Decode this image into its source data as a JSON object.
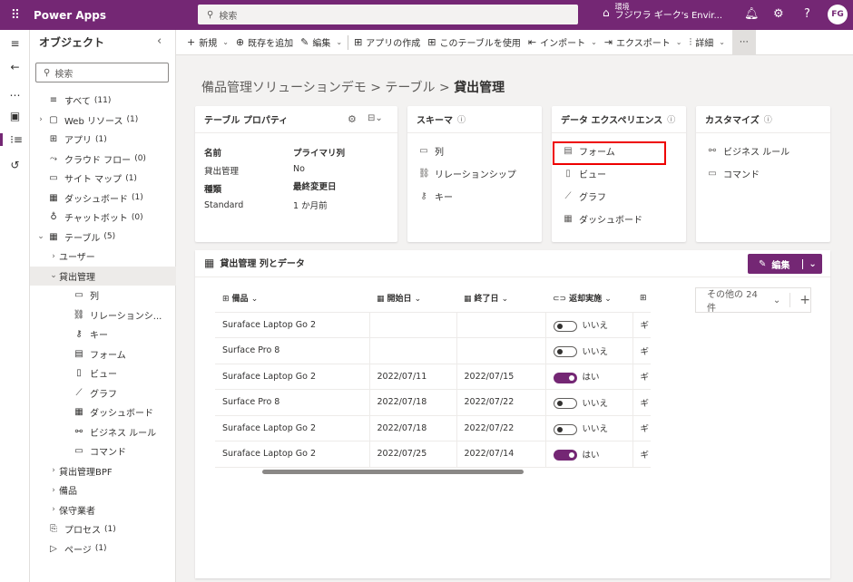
{
  "topbar": {
    "app_name": "Power Apps",
    "search_placeholder": "検索",
    "env_label": "環境",
    "env_name": "フジワラ ギーク's Envir...",
    "avatar_text": "FG"
  },
  "object_panel": {
    "title": "オブジェクト",
    "search_placeholder": "検索",
    "items": [
      {
        "label": "すべて",
        "count": "(11)",
        "icon": "≡",
        "chev": ""
      },
      {
        "label": "Web リソース",
        "count": "(1)",
        "icon": "▢",
        "chev": "›"
      },
      {
        "label": "アプリ",
        "count": "(1)",
        "icon": "⊞",
        "chev": ""
      },
      {
        "label": "クラウド フロー",
        "count": "(0)",
        "icon": "⤳",
        "chev": ""
      },
      {
        "label": "サイト マップ",
        "count": "(1)",
        "icon": "▭",
        "chev": ""
      },
      {
        "label": "ダッシュボード",
        "count": "(1)",
        "icon": "▦",
        "chev": ""
      },
      {
        "label": "チャットボット",
        "count": "(0)",
        "icon": "♁",
        "chev": ""
      },
      {
        "label": "テーブル",
        "count": "(5)",
        "icon": "▦",
        "chev": "⌄"
      },
      {
        "label": "ユーザー",
        "count": "",
        "icon": "",
        "chev": "›",
        "indent": 1
      },
      {
        "label": "貸出管理",
        "count": "",
        "icon": "",
        "chev": "⌄",
        "indent": 1,
        "selected": true
      },
      {
        "label": "列",
        "count": "",
        "icon": "▭",
        "chev": "",
        "indent": 2
      },
      {
        "label": "リレーションシ...",
        "count": "",
        "icon": "⛓",
        "chev": "",
        "indent": 2
      },
      {
        "label": "キー",
        "count": "",
        "icon": "⚷",
        "chev": "",
        "indent": 2
      },
      {
        "label": "フォーム",
        "count": "",
        "icon": "▤",
        "chev": "",
        "indent": 2
      },
      {
        "label": "ビュー",
        "count": "",
        "icon": "▯",
        "chev": "",
        "indent": 2
      },
      {
        "label": "グラフ",
        "count": "",
        "icon": "⟋",
        "chev": "",
        "indent": 2
      },
      {
        "label": "ダッシュボード",
        "count": "",
        "icon": "▦",
        "chev": "",
        "indent": 2
      },
      {
        "label": "ビジネス ルール",
        "count": "",
        "icon": "⚯",
        "chev": "",
        "indent": 2
      },
      {
        "label": "コマンド",
        "count": "",
        "icon": "▭",
        "chev": "",
        "indent": 2
      },
      {
        "label": "貸出管理BPF",
        "count": "",
        "icon": "",
        "chev": "›",
        "indent": 1
      },
      {
        "label": "備品",
        "count": "",
        "icon": "",
        "chev": "›",
        "indent": 1
      },
      {
        "label": "保守業者",
        "count": "",
        "icon": "",
        "chev": "›",
        "indent": 1
      },
      {
        "label": "プロセス",
        "count": "(1)",
        "icon": "⎘",
        "chev": ""
      },
      {
        "label": "ページ",
        "count": "(1)",
        "icon": "▷",
        "chev": ""
      }
    ]
  },
  "commands": [
    {
      "icon": "+",
      "label": "新規",
      "dd": true
    },
    {
      "icon": "⊕",
      "label": "既存を追加",
      "dd": false
    },
    {
      "icon": "✎",
      "label": "編集",
      "dd": true
    },
    {
      "icon": "⊞",
      "label": "アプリの作成",
      "dd": false
    },
    {
      "icon": "⊞",
      "label": "このテーブルを使用",
      "dd": false
    },
    {
      "icon": "⇤",
      "label": "インポート",
      "dd": true
    },
    {
      "icon": "⇥",
      "label": "エクスポート",
      "dd": true
    },
    {
      "icon": "⫶",
      "label": "詳細",
      "dd": true
    }
  ],
  "breadcrumb": {
    "part1": "備品管理ソリューションデモ",
    "sep": ">",
    "part2": "テーブル",
    "current": "貸出管理"
  },
  "props_card": {
    "title": "テーブル プロパティ",
    "name_label": "名前",
    "name_value": "貸出管理",
    "primary_label": "プライマリ列",
    "primary_value": "No",
    "type_label": "種類",
    "type_value": "Standard",
    "modified_label": "最終変更日",
    "modified_value": "1 か月前"
  },
  "schema_card": {
    "title": "スキーマ",
    "links": [
      {
        "icon": "▭",
        "label": "列"
      },
      {
        "icon": "⛓",
        "label": "リレーションシップ"
      },
      {
        "icon": "⚷",
        "label": "キー"
      }
    ]
  },
  "data_card": {
    "title": "データ エクスペリエンス",
    "links": [
      {
        "icon": "▤",
        "label": "フォーム"
      },
      {
        "icon": "▯",
        "label": "ビュー"
      },
      {
        "icon": "⟋",
        "label": "グラフ"
      },
      {
        "icon": "▦",
        "label": "ダッシュボード"
      }
    ]
  },
  "custom_card": {
    "title": "カスタマイズ",
    "links": [
      {
        "icon": "⚯",
        "label": "ビジネス ルール"
      },
      {
        "icon": "▭",
        "label": "コマンド"
      }
    ]
  },
  "grid": {
    "title": "貸出管理 列とデータ",
    "edit_label": "編集",
    "other_cols": "その他の 24 件",
    "columns": [
      "備品",
      "開始日",
      "終了日",
      "返却実施",
      ""
    ],
    "rows": [
      {
        "item": "Suraface Laptop Go 2",
        "start": "",
        "end": "",
        "returned": false,
        "ret_label": "いいえ",
        "next": "ギ"
      },
      {
        "item": "Surface Pro 8",
        "start": "",
        "end": "",
        "returned": false,
        "ret_label": "いいえ",
        "next": "ギ"
      },
      {
        "item": "Suraface Laptop Go 2",
        "start": "2022/07/11",
        "end": "2022/07/15",
        "returned": true,
        "ret_label": "はい",
        "next": "ギ"
      },
      {
        "item": "Surface Pro 8",
        "start": "2022/07/18",
        "end": "2022/07/22",
        "returned": false,
        "ret_label": "いいえ",
        "next": "ギ"
      },
      {
        "item": "Suraface Laptop Go 2",
        "start": "2022/07/18",
        "end": "2022/07/22",
        "returned": false,
        "ret_label": "いいえ",
        "next": "ギ"
      },
      {
        "item": "Suraface Laptop Go 2",
        "start": "2022/07/25",
        "end": "2022/07/14",
        "returned": true,
        "ret_label": "はい",
        "next": "ギ"
      }
    ]
  }
}
